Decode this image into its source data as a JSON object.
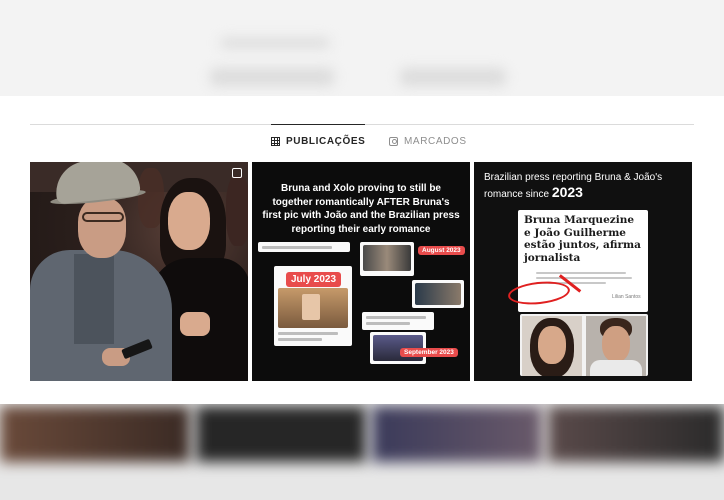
{
  "tabs": [
    {
      "label": "PUBLICAÇÕES",
      "icon": "grid-icon",
      "active": true
    },
    {
      "label": "MARCADOS",
      "icon": "tagged-icon",
      "active": false
    }
  ],
  "posts": [
    {
      "type": "photo",
      "icon": "multiple-images-icon"
    },
    {
      "type": "text-collage",
      "title": "Bruna and Xolo proving to still be together romantically AFTER Bruna's first pic with João and the Brazilian press reporting their early romance",
      "labels": {
        "july": "July 2023",
        "august": "August 2023",
        "september": "September 2023"
      }
    },
    {
      "type": "article-collage",
      "title_prefix": "Brazilian press reporting Bruna & João's romance since",
      "title_year": "2023",
      "article_headline": "Bruna Marquezine e João Guilherme estão juntos, afirma jornalista",
      "article_author": "Lilian Santos"
    }
  ],
  "colors": {
    "highlight_red": "#e84c4c",
    "circle_red": "#e02020",
    "active_tab": "#262626",
    "inactive_tab": "#8e8e8e"
  }
}
